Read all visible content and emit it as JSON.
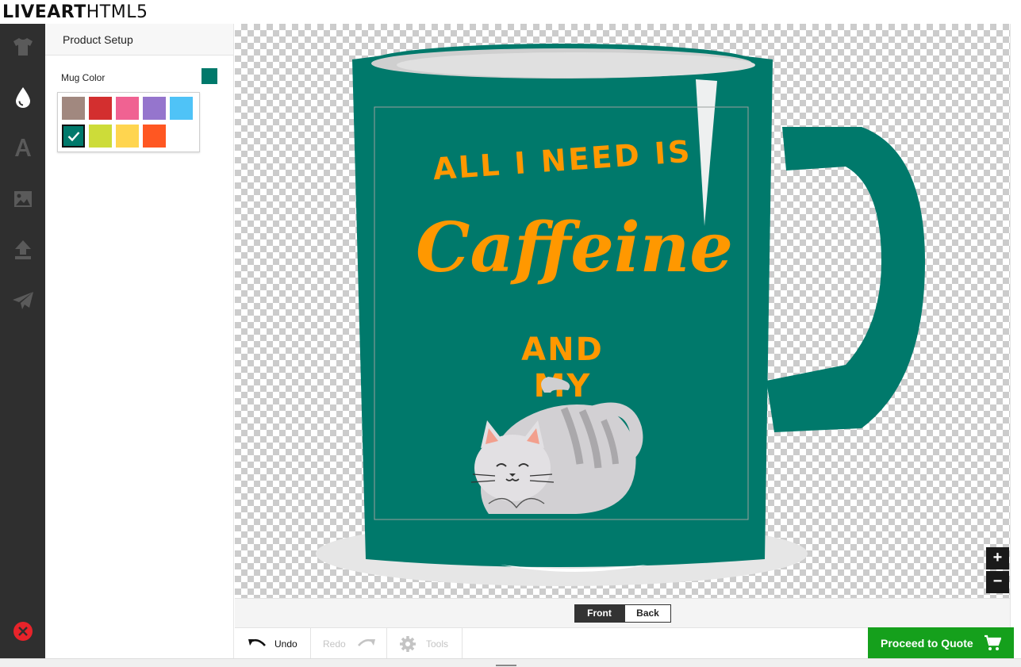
{
  "app": {
    "logo_bold": "LIVEART",
    "logo_light": "HTML5"
  },
  "sidebar": {
    "items": [
      {
        "name": "tshirt-icon"
      },
      {
        "name": "color-drop-icon"
      },
      {
        "name": "text-icon"
      },
      {
        "name": "image-icon"
      },
      {
        "name": "upload-icon"
      },
      {
        "name": "send-icon"
      }
    ],
    "close_icon": "close-icon"
  },
  "panel": {
    "title": "Product Setup",
    "mug_color_label": "Mug Color",
    "current_color": "#00796b",
    "swatches": [
      {
        "color": "#a1887f",
        "selected": false
      },
      {
        "color": "#d32f2f",
        "selected": false
      },
      {
        "color": "#f06292",
        "selected": false
      },
      {
        "color": "#9575cd",
        "selected": false
      },
      {
        "color": "#4fc3f7",
        "selected": false
      },
      {
        "color": "#00796b",
        "selected": true
      },
      {
        "color": "#cddc39",
        "selected": false
      },
      {
        "color": "#ffd54f",
        "selected": false
      },
      {
        "color": "#ff5722",
        "selected": false
      }
    ]
  },
  "design": {
    "line1": "ALL I NEED IS",
    "line2": "Caffeine",
    "line3": "AND MY",
    "text_color": "#ff9800",
    "mug_color": "#00796b"
  },
  "zoom": {
    "in": "+",
    "out": "−"
  },
  "sides": {
    "front": "Front",
    "back": "Back",
    "active": "Front"
  },
  "toolbar": {
    "undo": "Undo",
    "redo": "Redo",
    "tools": "Tools"
  },
  "quote": {
    "label": "Proceed to Quote"
  }
}
